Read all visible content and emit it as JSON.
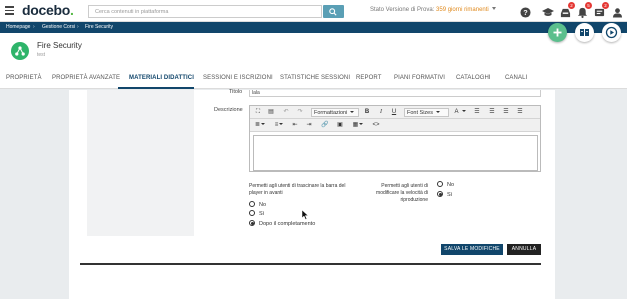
{
  "topbar": {
    "logo": "docebo",
    "logo_dot": ".",
    "search_placeholder": "Cerca contenuti in piattaforma",
    "trial_label": "Stato Versione di Prova:",
    "trial_days": "359 giorni rimanenti",
    "badges": {
      "inbox": "2",
      "notifications": "5",
      "alerts": "2"
    }
  },
  "breadcrumb": {
    "items": [
      "Homepage",
      "Gestione Corsi",
      "Fire Security"
    ],
    "separator": "›"
  },
  "course": {
    "title": "Fire Security",
    "subtitle": "test"
  },
  "tabs": [
    {
      "label": "PROPRIETÀ",
      "active": false
    },
    {
      "label": "PROPRIETÀ AVANZATE",
      "active": false
    },
    {
      "label": "MATERIALI DIDATTICI",
      "active": true
    },
    {
      "label": "SESSIONI E ISCRIZIONI",
      "active": false
    },
    {
      "label": "STATISTICHE SESSIONI",
      "active": false
    },
    {
      "label": "REPORT",
      "active": false
    },
    {
      "label": "PIANI FORMATIVI",
      "active": false
    },
    {
      "label": "CATALOGHI",
      "active": false
    },
    {
      "label": "CANALI",
      "active": false
    }
  ],
  "form": {
    "title_label": "Titolo",
    "title_value": "lala",
    "description_label": "Descrizione",
    "editor": {
      "format_select": "Formattazioni",
      "font_size_select": "Font Sizes",
      "bold": "B",
      "italic": "I",
      "underline": "U",
      "text_color": "A"
    },
    "seek_question": "Permetti agli utenti di trascinare la barra del player in avanti",
    "seek_options": [
      {
        "label": "No",
        "checked": false
      },
      {
        "label": "Sì",
        "checked": false
      },
      {
        "label": "Dopo il completamento",
        "checked": true
      }
    ],
    "speed_question": "Permetti agli utenti di modificare la velocità di riproduzione",
    "speed_options": [
      {
        "label": "No",
        "checked": false
      },
      {
        "label": "Sì",
        "checked": true
      }
    ],
    "save_button": "SALVA LE MODIFICHE",
    "cancel_button": "ANNULLA"
  },
  "colors": {
    "brand_dark_blue": "#11466b",
    "brand_green": "#58b947",
    "course_icon_green": "#2eb46a",
    "fab_green": "#5bbf8d",
    "trial_orange": "#e08a1e",
    "badge_red": "#e53935"
  },
  "icons": [
    "hamburger-icon",
    "search-icon",
    "help-icon",
    "graduation-cap-icon",
    "inbox-icon",
    "bell-icon",
    "alert-icon",
    "user-icon",
    "share-icon",
    "plus-icon",
    "catalog-icon",
    "play-icon"
  ]
}
